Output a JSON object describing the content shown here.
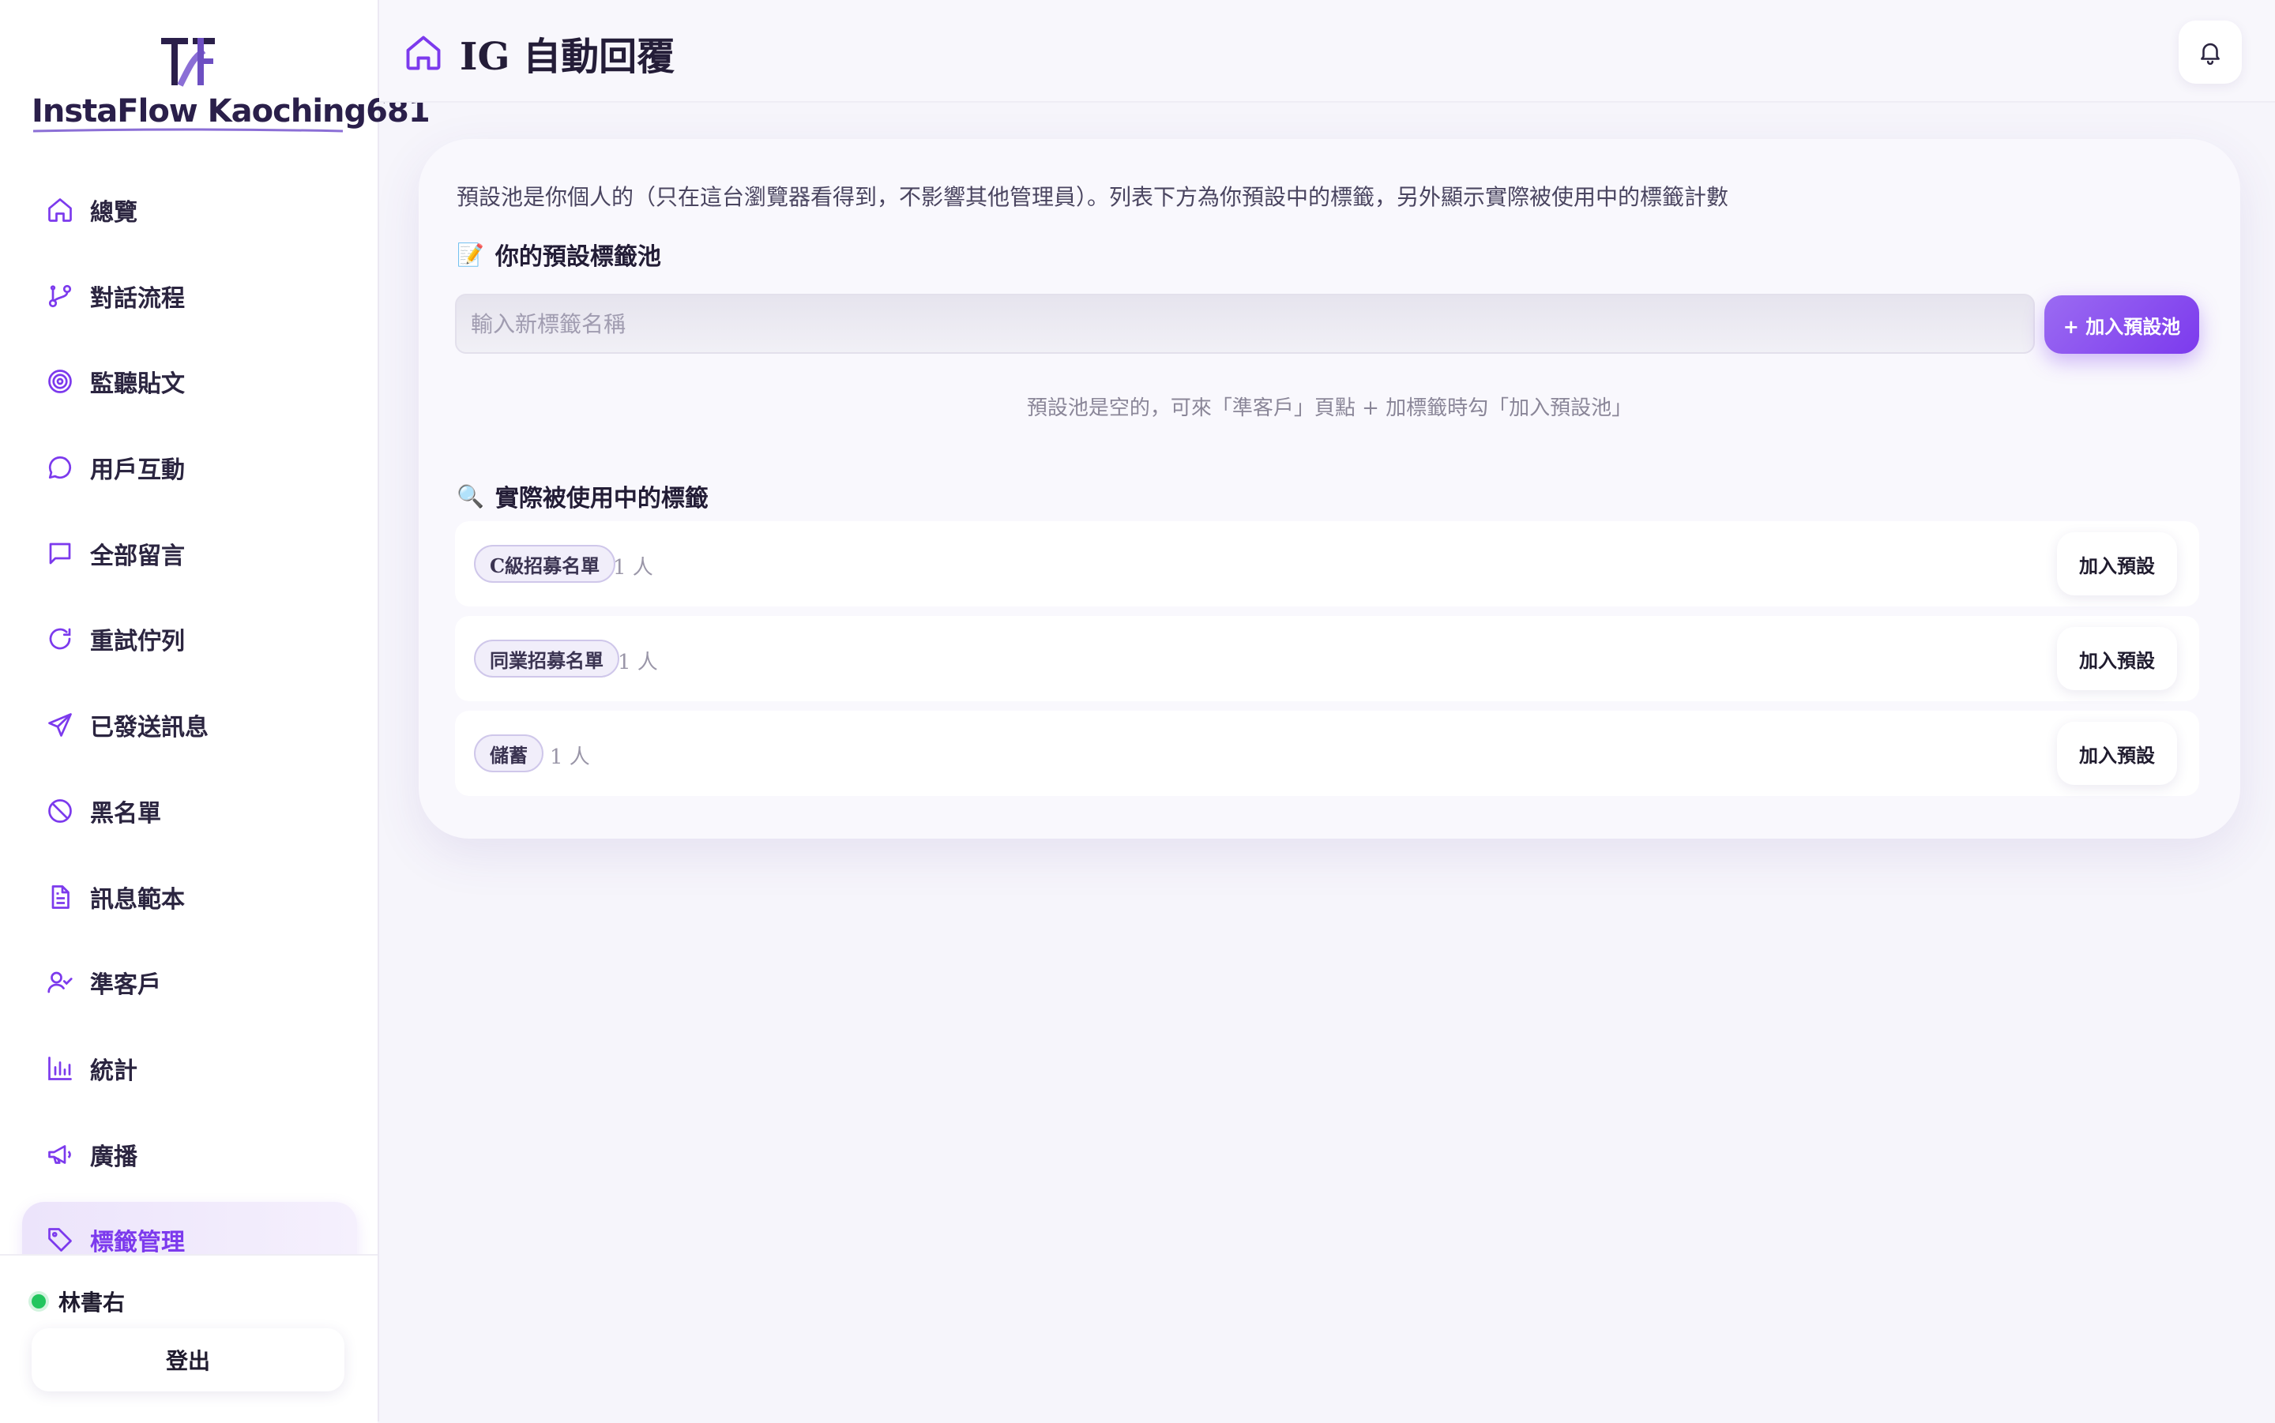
{
  "brand": {
    "name": "InstaFlow Kaoching681"
  },
  "sidebar": {
    "items": [
      {
        "label": "總覽",
        "icon": "home-icon"
      },
      {
        "label": "對話流程",
        "icon": "git-branch-icon"
      },
      {
        "label": "監聽貼文",
        "icon": "target-icon"
      },
      {
        "label": "用戶互動",
        "icon": "chat-bubble-icon"
      },
      {
        "label": "全部留言",
        "icon": "message-square-icon"
      },
      {
        "label": "重試佇列",
        "icon": "refresh-icon"
      },
      {
        "label": "已發送訊息",
        "icon": "send-icon"
      },
      {
        "label": "黑名單",
        "icon": "ban-icon"
      },
      {
        "label": "訊息範本",
        "icon": "file-text-icon"
      },
      {
        "label": "準客戶",
        "icon": "user-check-icon"
      },
      {
        "label": "統計",
        "icon": "bar-chart-icon"
      },
      {
        "label": "廣播",
        "icon": "megaphone-icon"
      },
      {
        "label": "標籤管理",
        "icon": "tag-icon"
      }
    ],
    "active_index": 12,
    "user": {
      "name": "林書右",
      "status": "online"
    },
    "logout_label": "登出"
  },
  "header": {
    "title": "IG 自動回覆",
    "title_icon": "home-icon",
    "bell_icon": "bell-icon"
  },
  "main": {
    "description": "預設池是你個人的（只在這台瀏覽器看得到，不影響其他管理員）。列表下方為你預設中的標籤，另外顯示實際被使用中的標籤計數",
    "preset_section": {
      "emoji": "📝",
      "title": "你的預設標籤池",
      "input_placeholder": "輸入新標籤名稱",
      "add_button": "+ 加入預設池",
      "empty_message": "預設池是空的，可來「準客戶」頁點 + 加標籤時勾「加入預設池」"
    },
    "used_section": {
      "emoji": "🔍",
      "title": "實際被使用中的標籤",
      "rows": [
        {
          "tag": "C級招募名單",
          "count": "1 人",
          "action": "加入預設"
        },
        {
          "tag": "同業招募名單",
          "count": "1 人",
          "action": "加入預設"
        },
        {
          "tag": "儲蓄",
          "count": "1 人",
          "action": "加入預設"
        }
      ]
    }
  },
  "colors": {
    "accent": "#7c3aed",
    "accent_light": "#9b6bf2",
    "online": "#22c55e",
    "background": "#f6f5fb"
  }
}
